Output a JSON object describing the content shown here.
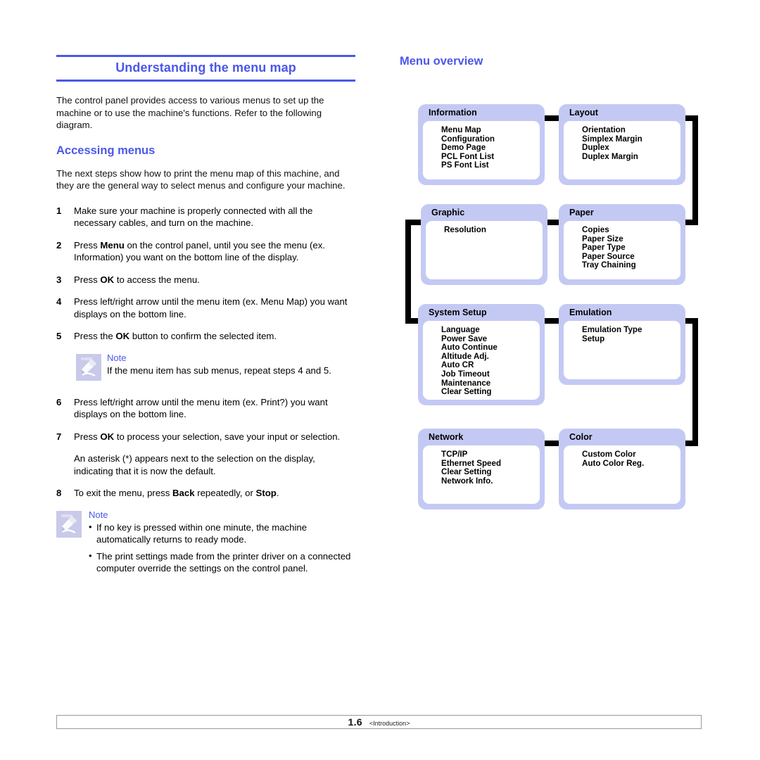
{
  "left": {
    "heading": "Understanding the menu map",
    "intro": "The control panel provides access to various menus to set up the machine or to use the machine's functions. Refer to the following diagram.",
    "subheading": "Accessing menus",
    "subintro": "The next steps show how to print the menu map of this machine, and they are the general way to select menus and configure your machine.",
    "steps": [
      {
        "num": "1",
        "text": "Make sure your machine is properly connected with all the necessary cables, and turn on the machine."
      },
      {
        "num": "2",
        "text_a": "Press ",
        "bold_a": "Menu",
        "text_b": " on the control panel, until you see the menu (ex. Information) you want on the bottom line of the display."
      },
      {
        "num": "3",
        "text_a": "Press ",
        "bold_a": "OK",
        "text_b": " to access the menu."
      },
      {
        "num": "4",
        "text": "Press left/right arrow until the menu item (ex. Menu Map) you want displays on the bottom line."
      },
      {
        "num": "5",
        "text_a": "Press the ",
        "bold_a": "OK",
        "text_b": " button to confirm the selected item."
      },
      {
        "num": "6",
        "text": "Press left/right arrow until the menu item (ex. Print?) you want displays on the bottom line."
      },
      {
        "num": "7",
        "text_a": "Press ",
        "bold_a": "OK",
        "text_b": " to process your selection, save your input or selection."
      },
      {
        "num": "8",
        "text_a": "To exit the menu, press ",
        "bold_a": "Back",
        "text_b": " repeatedly, or ",
        "bold_b": "Stop",
        "text_c": "."
      }
    ],
    "step7_sub": "An asterisk (*) appears next to the selection on the display, indicating that it is now the default.",
    "note1": {
      "title": "Note",
      "body": "If the menu item has sub menus, repeat steps 4 and 5."
    },
    "note2": {
      "title": "Note",
      "bullets": [
        "If no key is pressed within one minute, the machine automatically returns to ready mode.",
        "The print settings made from the printer driver on a connected computer override the settings on the control panel."
      ]
    }
  },
  "right": {
    "heading": "Menu overview",
    "boxes": [
      {
        "title": "Information",
        "items": [
          "Menu Map",
          "Configuration",
          "Demo Page",
          "PCL Font List",
          "PS Font List"
        ]
      },
      {
        "title": "Layout",
        "items": [
          "Orientation",
          "Simplex Margin",
          "Duplex",
          "Duplex Margin"
        ]
      },
      {
        "title": "Graphic",
        "items": [
          "Resolution"
        ]
      },
      {
        "title": "Paper",
        "items": [
          "Copies",
          "Paper Size",
          "Paper Type",
          "Paper Source",
          "Tray Chaining"
        ]
      },
      {
        "title": "System Setup",
        "items": [
          "Language",
          "Power Save",
          "Auto Continue",
          "Altitude Adj.",
          "Auto CR",
          "Job Timeout",
          "Maintenance",
          "Clear Setting"
        ]
      },
      {
        "title": "Emulation",
        "items": [
          "Emulation Type",
          "Setup"
        ]
      },
      {
        "title": "Network",
        "items": [
          "TCP/IP",
          "Ethernet Speed",
          "Clear Setting",
          "Network Info."
        ]
      },
      {
        "title": "Color",
        "items": [
          "Custom Color",
          "Auto Color Reg."
        ]
      }
    ]
  },
  "footer": {
    "page": "1.6",
    "section": "<Introduction>"
  },
  "colors": {
    "accent_blue": "#4a58e8",
    "box_lavender": "#c4c9f4",
    "note_icon": "#c9c9ea",
    "connector": "#000000"
  }
}
